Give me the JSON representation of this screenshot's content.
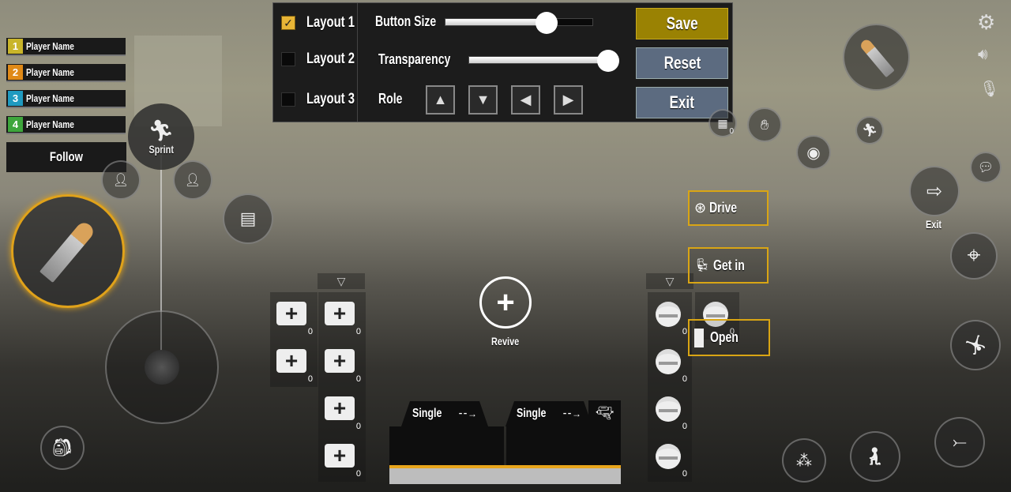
{
  "settings_panel": {
    "layouts": [
      {
        "label": "Layout 1",
        "checked": true
      },
      {
        "label": "Layout 2",
        "checked": false
      },
      {
        "label": "Layout 3",
        "checked": false
      }
    ],
    "button_size": {
      "label": "Button Size",
      "value": 0.69
    },
    "transparency": {
      "label": "Transparency",
      "value": 0.94
    },
    "role": {
      "label": "Role",
      "arrows": [
        "▲",
        "▼",
        "◀",
        "▶"
      ]
    },
    "save_label": "Save",
    "reset_label": "Reset",
    "exit_label": "Exit",
    "colors": {
      "save": "#9a8203",
      "reset": "#5c6b80",
      "exit": "#5c6b80",
      "checkbox_on": "#e8b536"
    }
  },
  "team": {
    "players": [
      {
        "num": "1",
        "name": "Player Name",
        "color": "#c9b52a"
      },
      {
        "num": "2",
        "name": "Player Name",
        "color": "#e08a17"
      },
      {
        "num": "3",
        "name": "Player Name",
        "color": "#1f9ac0"
      },
      {
        "num": "4",
        "name": "Player Name",
        "color": "#3ea63c"
      }
    ],
    "follow_label": "Follow"
  },
  "controls": {
    "sprint_label": "Sprint",
    "revive_label": "Revive",
    "exit_label": "Exit",
    "drive_label": "Drive",
    "get_in_label": "Get in",
    "open_label": "Open",
    "medkit_counts": [
      "0",
      "0",
      "0",
      "0",
      "0",
      "0"
    ],
    "grenade_counts": [
      "0",
      "0",
      "0",
      "0",
      "0"
    ],
    "misc_count": "0"
  },
  "weapons": [
    {
      "fire_mode": "Single"
    },
    {
      "fire_mode": "Single"
    }
  ],
  "accent_color": "#d9a514"
}
